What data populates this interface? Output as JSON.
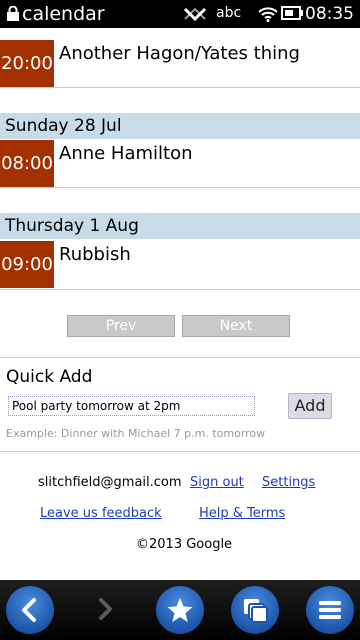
{
  "status_bar": {
    "app_title": "calendar",
    "keyboard_indicator": "abc",
    "time": "08:35",
    "icons": [
      "lock-icon",
      "notification-icon",
      "wifi-icon",
      "battery-icon"
    ]
  },
  "events": [
    {
      "time": "20:00",
      "title": "Another Hagon/Yates thing"
    },
    {
      "time": "08:00",
      "title": "Anne Hamilton"
    },
    {
      "time": "09:00",
      "title": "Rubbish"
    }
  ],
  "days": [
    {
      "label": "Sunday 28 Jul"
    },
    {
      "label": "Thursday 1 Aug"
    }
  ],
  "pager": {
    "prev_label": "Prev",
    "next_label": "Next"
  },
  "quick_add": {
    "title": "Quick Add",
    "input_value": "Pool party tomorrow at 2pm",
    "button_label": "Add",
    "example": "Example: Dinner with Michael 7 p.m. tomorrow"
  },
  "footer": {
    "account": "slitchfield@gmail.com",
    "sign_out": "Sign out",
    "settings": "Settings",
    "feedback": "Leave us feedback",
    "help": "Help & Terms",
    "copyright": "©2013 Google"
  },
  "toolbar": {
    "icons": [
      "back-icon",
      "forward-icon",
      "star-icon",
      "windows-icon",
      "menu-icon"
    ]
  },
  "colors": {
    "time_block": "#a33100",
    "day_header": "#c7dbe9",
    "link": "#1d3cb7",
    "toolbar_button": "#2a6cc4"
  }
}
